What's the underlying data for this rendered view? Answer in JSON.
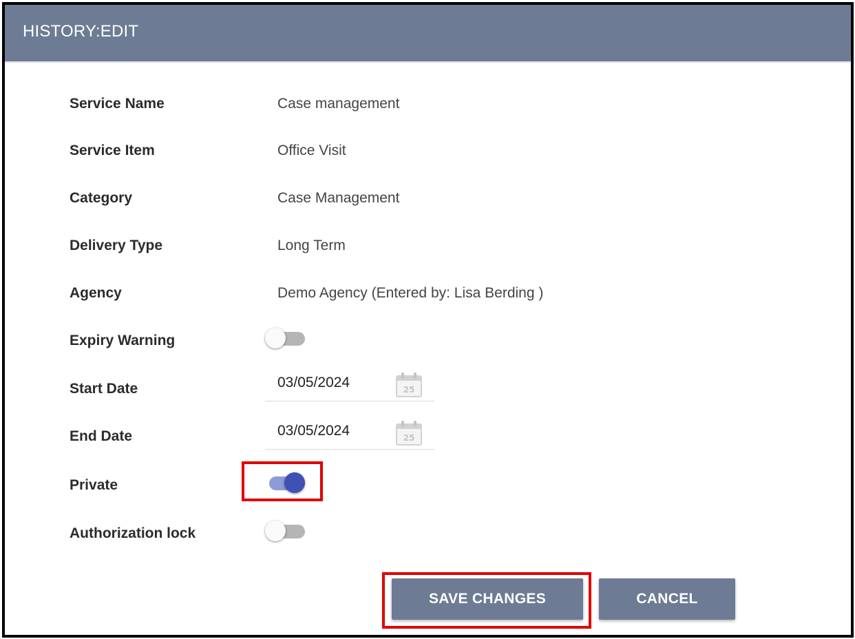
{
  "header": {
    "title": "HISTORY:EDIT"
  },
  "fields": {
    "service_name": {
      "label": "Service Name",
      "value": "Case management"
    },
    "service_item": {
      "label": "Service Item",
      "value": "Office Visit"
    },
    "category": {
      "label": "Category",
      "value": "Case Management"
    },
    "delivery_type": {
      "label": "Delivery Type",
      "value": "Long Term"
    },
    "agency": {
      "label": "Agency",
      "value": "Demo Agency (Entered by: Lisa Berding )"
    },
    "expiry_warning": {
      "label": "Expiry Warning",
      "on": false
    },
    "start_date": {
      "label": "Start Date",
      "value": "03/05/2024",
      "calendar_icon": "calendar-icon",
      "calendar_day": "25"
    },
    "end_date": {
      "label": "End Date",
      "value": "03/05/2024",
      "calendar_icon": "calendar-icon",
      "calendar_day": "25"
    },
    "private": {
      "label": "Private",
      "on": true
    },
    "authorization_lock": {
      "label": "Authorization lock",
      "on": false
    }
  },
  "buttons": {
    "save": "SAVE CHANGES",
    "cancel": "CANCEL"
  },
  "colors": {
    "header_bg": "#6d7c94",
    "button_bg": "#6d7c94",
    "toggle_on_thumb": "#3f51b5",
    "toggle_on_track": "#8e9bd8",
    "highlight": "#e00000"
  }
}
